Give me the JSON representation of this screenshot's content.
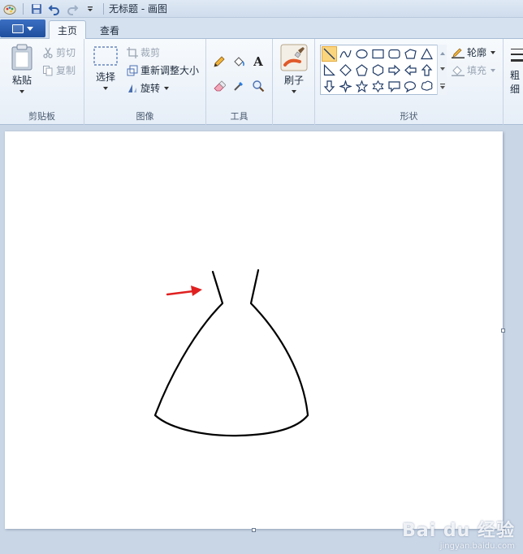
{
  "window": {
    "title": "无标题 - 画图"
  },
  "tabs": {
    "home": "主页",
    "view": "查看"
  },
  "clipboard": {
    "paste": "粘贴",
    "cut": "剪切",
    "copy": "复制",
    "label": "剪贴板"
  },
  "image": {
    "select": "选择",
    "crop": "裁剪",
    "resize": "重新调整大小",
    "rotate": "旋转",
    "label": "图像"
  },
  "tools": {
    "label": "工具",
    "text_glyph": "A"
  },
  "brushes": {
    "label": "刷子"
  },
  "shapes": {
    "outline": "轮廓",
    "fill": "填充",
    "label": "形状"
  },
  "size": {
    "label_partial": "粗",
    "label_partial2": "细"
  },
  "watermark": {
    "logo": "Bai du 经验",
    "url": "jingyan.baidu.com"
  },
  "colors": {
    "accent": "#1f4f9e",
    "selected_shape": "#fbd57e",
    "arrow": "#e02020",
    "drawing": "#000000"
  }
}
